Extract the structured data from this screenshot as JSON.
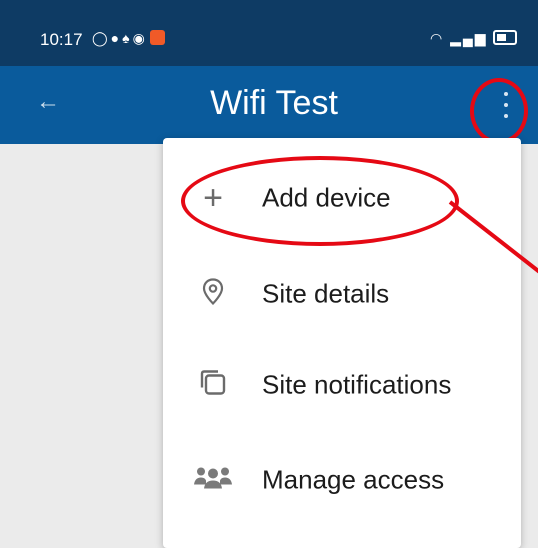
{
  "status_bar": {
    "time": "10:17",
    "left_icons": [
      "whatsapp-icon",
      "chat-icon",
      "notification-icon",
      "app-icon",
      "shield-icon"
    ],
    "right_icons": [
      "wifi-icon",
      "signal-icon",
      "battery-icon"
    ]
  },
  "app_bar": {
    "title": "Wifi Test",
    "back_icon": "arrow-left-icon",
    "overflow_icon": "more-vert-icon"
  },
  "menu": {
    "items": [
      {
        "label": "Add device",
        "icon": "plus-icon"
      },
      {
        "label": "Site details",
        "icon": "location-pin-icon"
      },
      {
        "label": "Site notifications",
        "icon": "copy-icon"
      },
      {
        "label": "Manage access",
        "icon": "people-icon"
      }
    ]
  },
  "annotations": {
    "color": "#e50914"
  },
  "colors": {
    "status_bar": "#0e3b64",
    "app_bar": "#0a5b9c",
    "background": "#ebebeb"
  }
}
